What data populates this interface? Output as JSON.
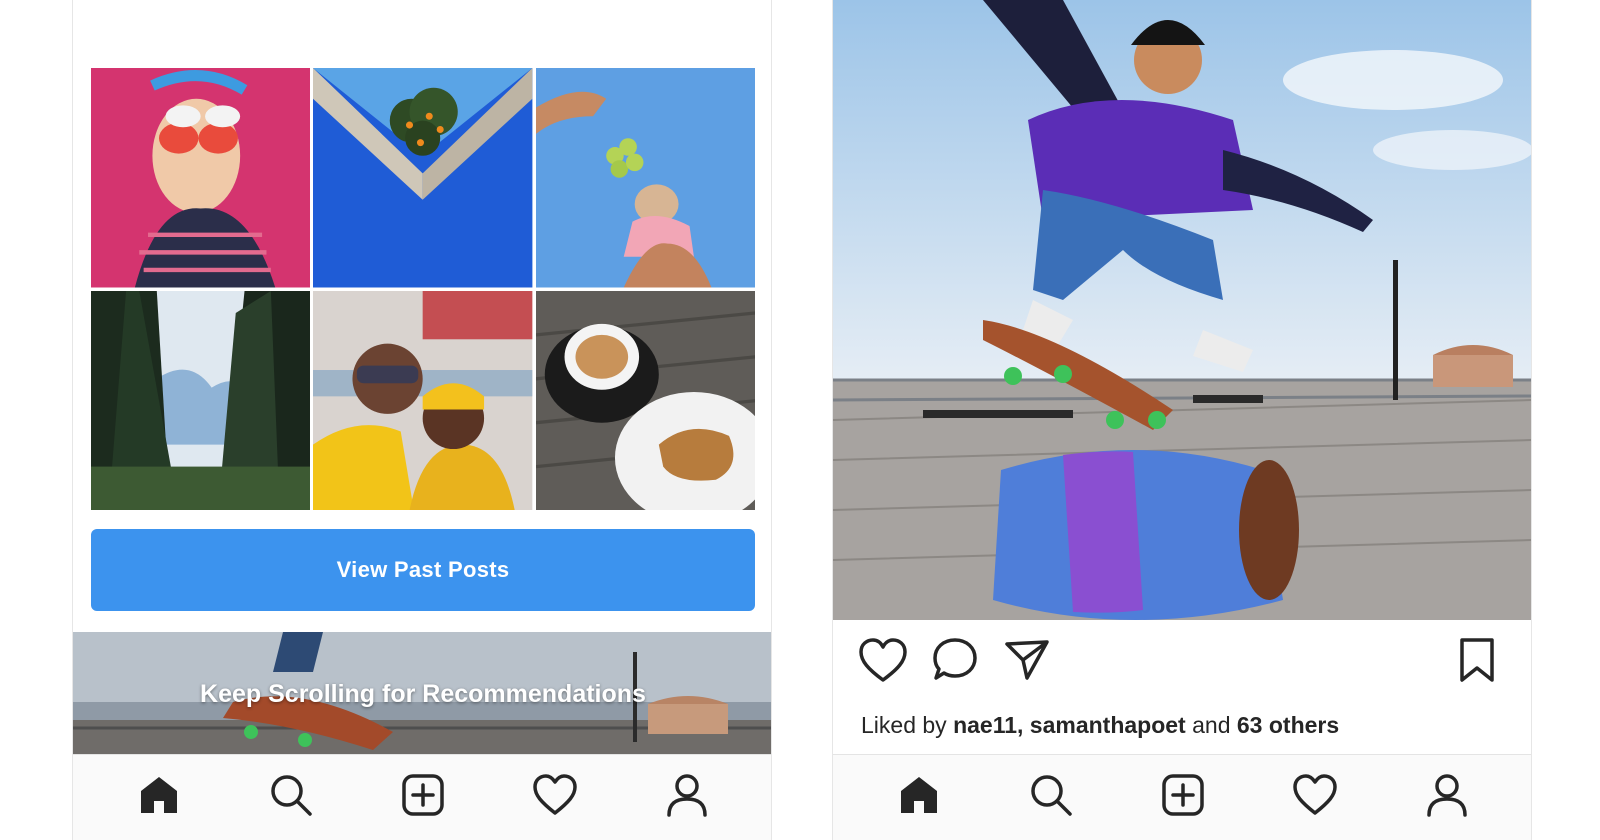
{
  "left": {
    "grid_photos": [
      "photo-glasses-portrait",
      "photo-orange-tree-wall",
      "photo-chihuahua-grapes",
      "photo-forest-trees",
      "photo-friends-selfie",
      "photo-coffee-sandwich"
    ],
    "view_past_posts_label": "View Past Posts",
    "recommendations_label": "Keep Scrolling for Recommendations"
  },
  "right": {
    "liked_by_prefix": "Liked by",
    "liked_by_user1": "nae11,",
    "liked_by_user2": "samanthapoet",
    "liked_by_and": "and",
    "liked_by_others": "63 others"
  },
  "tabbar": {
    "icons": [
      "home-icon",
      "search-icon",
      "add-post-icon",
      "activity-heart-icon",
      "profile-icon"
    ],
    "active": "home-icon"
  },
  "colors": {
    "accent_blue": "#3c93ee",
    "icon_dark": "#262626",
    "tabbar_bg": "#fafafa"
  }
}
